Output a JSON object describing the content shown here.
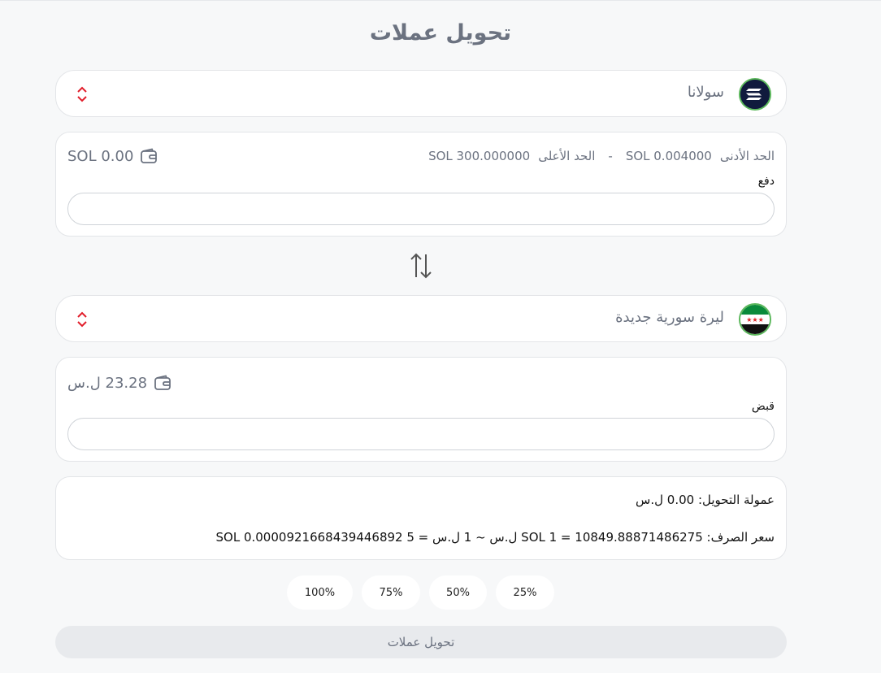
{
  "title": "تحويل عملات",
  "from": {
    "currency_name": "سولانا",
    "balance": "SOL 0.00",
    "limits": {
      "min_label": "الحد الأدنى",
      "min_value": "SOL 0.004000",
      "separator": "-",
      "max_label": "الحد الأعلى",
      "max_value": "SOL 300.000000"
    },
    "field_label": "دفع",
    "input_value": ""
  },
  "to": {
    "currency_name": "ليرة سورية جديدة",
    "balance": "23.28 ل.س",
    "field_label": "قبض",
    "input_value": ""
  },
  "info": {
    "fee": "عمولة التحويل: 0.00 ل.س",
    "rate": "سعر الصرف: SOL 1 = 10849.88871486275 ل.س ~ 1 ل.س = SOL 0.0000921668439446892 5"
  },
  "percent_buttons": [
    "100%",
    "75%",
    "50%",
    "25%"
  ],
  "submit_label": "تحويل عملات",
  "colors": {
    "accent_red": "#e11d2a",
    "text_muted": "#6b7280",
    "border": "#e3e5e8",
    "solana_bg": "#101a3d",
    "flag_green": "#0a8a3a"
  },
  "icons": {
    "from_coin": "solana-icon",
    "to_coin": "syria-flag-icon",
    "wallet": "wallet-icon",
    "swap": "swap-arrows-icon",
    "sort": "sort-arrows-icon"
  }
}
